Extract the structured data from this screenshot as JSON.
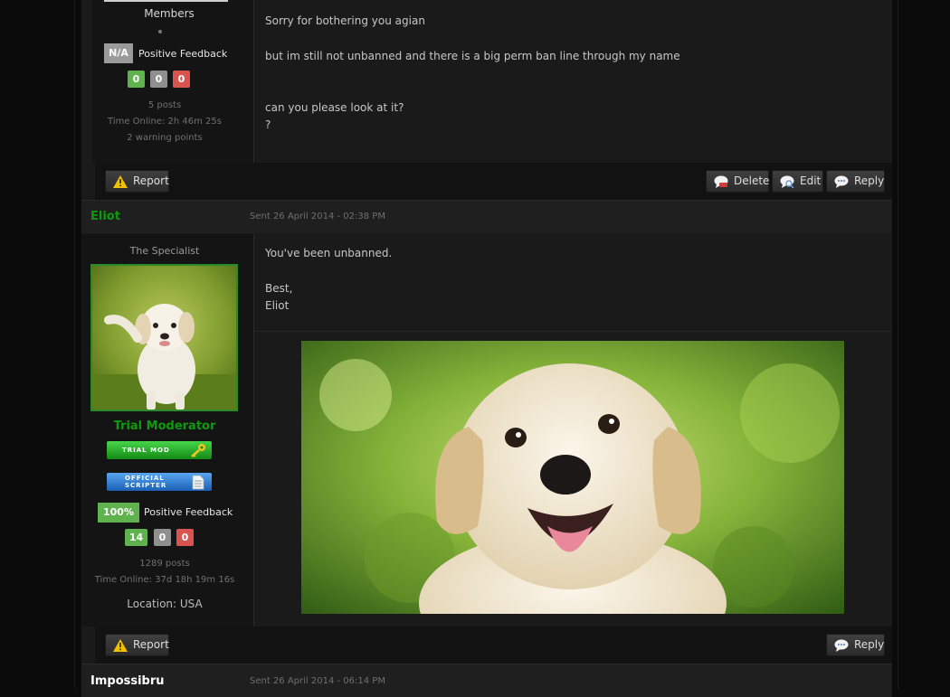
{
  "post1": {
    "group": "Members",
    "feedback_percent": "N/A",
    "feedback_label": "Positive Feedback",
    "feedback_counts": [
      "0",
      "0",
      "0"
    ],
    "posts": "5 posts",
    "time_online": "Time Online: 2h 46m 25s",
    "warning_points": "2 warning points",
    "lines": [
      "Sorry for bothering you agian",
      "but im still not unbanned and there is a big perm ban line through my name",
      "can you please look at it?",
      "?"
    ],
    "buttons": {
      "report": "Report",
      "delete": "Delete",
      "edit": "Edit",
      "reply": "Reply"
    }
  },
  "post2": {
    "author": "Eliot",
    "date": "Sent 26 April 2014 - 02:38 PM",
    "user_title": "The Specialist",
    "group": "Trial Moderator",
    "badges": [
      {
        "line1": "TRIAL MOD",
        "line2": "",
        "icon": "key-icon"
      },
      {
        "line1": "OFFICIAL",
        "line2": "SCRIPTER",
        "icon": "document-icon"
      }
    ],
    "feedback_percent": "100%",
    "feedback_label": "Positive Feedback",
    "feedback_counts": [
      "14",
      "0",
      "0"
    ],
    "posts": "1289 posts",
    "time_online": "Time Online: 37d 18h 19m 16s",
    "location": "Location: USA",
    "lines": [
      "You've been unbanned.",
      "Best,",
      "Eliot"
    ],
    "buttons": {
      "report": "Report",
      "reply": "Reply"
    }
  },
  "post3": {
    "author": "Impossibru",
    "date": "Sent 26 April 2014 - 06:14 PM"
  },
  "colors": {
    "moderator_green": "#0d9a0d",
    "positive": "#5fb24e",
    "neutral": "#8f8f8f",
    "negative": "#d9534f"
  }
}
